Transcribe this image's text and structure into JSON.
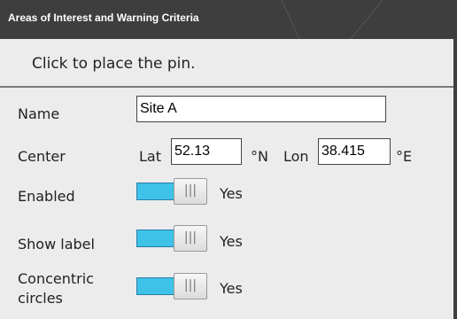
{
  "window": {
    "title": "Areas of Interest and Warning Criteria"
  },
  "hint": "Click to place the pin.",
  "form": {
    "name_label": "Name",
    "name_value": "Site A",
    "center_label": "Center",
    "lat_label": "Lat",
    "lat_value": "52.13",
    "lat_unit": "°N",
    "lon_label": "Lon",
    "lon_value": "38.415",
    "lon_unit": "°E",
    "enabled_label": "Enabled",
    "enabled_state": "Yes",
    "show_label_label": "Show label",
    "show_label_state": "Yes",
    "concentric_label_line1": "Concentric",
    "concentric_label_line2": "circles",
    "concentric_state": "Yes",
    "toggle_grip": "|||"
  },
  "colors": {
    "titlebar": "#3e3e3e",
    "panel": "#ececec",
    "toggle_on": "#3ec2e8"
  }
}
